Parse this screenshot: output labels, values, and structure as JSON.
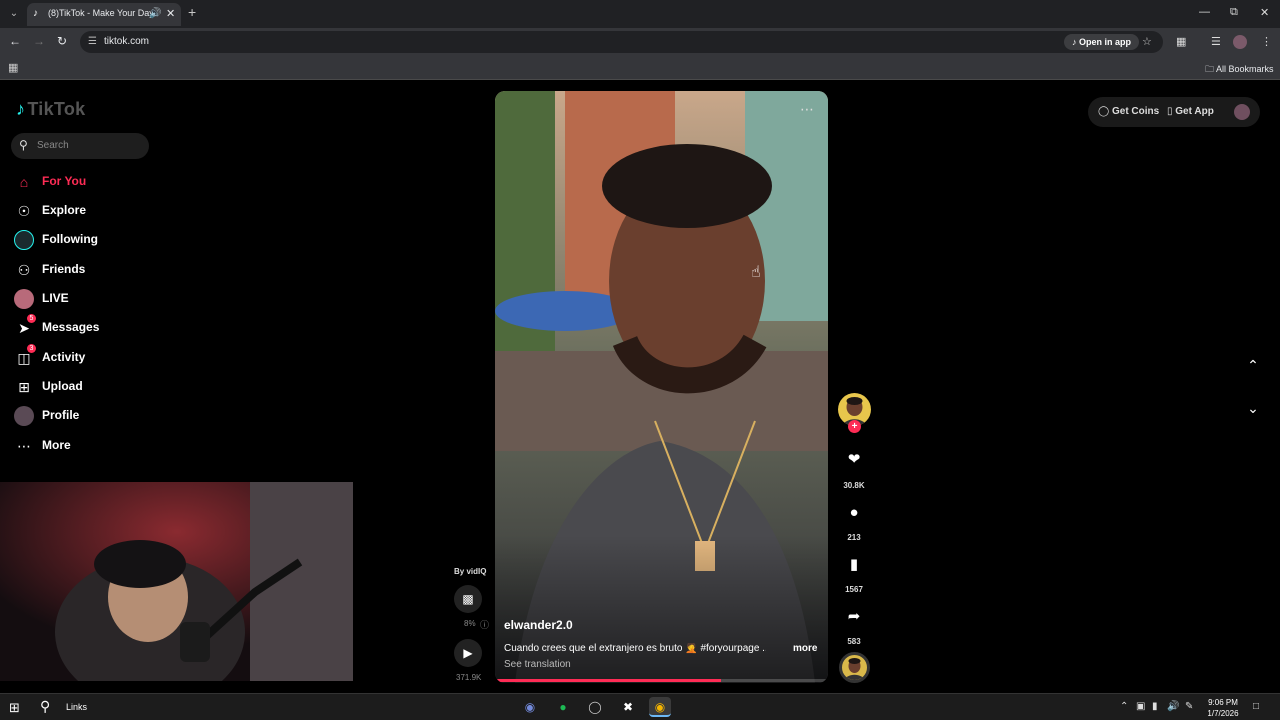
{
  "browser": {
    "tab_title": "(8)TikTok - Make Your Day",
    "url": "tiktok.com",
    "open_in_app": "Open in app",
    "bookmarks_label": "All Bookmarks"
  },
  "sidebar": {
    "logo": "TikTok",
    "search_placeholder": "Search",
    "items": [
      {
        "label": "For You",
        "icon": "home-icon",
        "active": true
      },
      {
        "label": "Explore",
        "icon": "compass-icon"
      },
      {
        "label": "Following",
        "icon": "following-avatar"
      },
      {
        "label": "Friends",
        "icon": "friends-icon"
      },
      {
        "label": "LIVE",
        "icon": "live-avatar"
      },
      {
        "label": "Messages",
        "icon": "messages-icon",
        "badge": "5"
      },
      {
        "label": "Activity",
        "icon": "activity-icon",
        "badge": "3"
      },
      {
        "label": "Upload",
        "icon": "upload-icon"
      },
      {
        "label": "Profile",
        "icon": "profile-avatar"
      },
      {
        "label": "More",
        "icon": "more-icon"
      }
    ]
  },
  "video": {
    "author": "elwander2.0",
    "caption": "Cuando crees que el extranjero es bruto 🤦 #foryourpage ...",
    "caption_more": "more",
    "see_translation": "See translation",
    "progress_fraction": 0.68
  },
  "vidiq": {
    "by_label": "By vidIQ",
    "percent": "8%",
    "views": "371.9K"
  },
  "actions": {
    "likes": "30.8K",
    "comments": "213",
    "saves": "1567",
    "shares": "583"
  },
  "header": {
    "get_coins": "Get Coins",
    "get_app": "Get App"
  },
  "taskbar": {
    "links_label": "Links",
    "time": "9:06 PM",
    "date": "1/7/2026"
  }
}
